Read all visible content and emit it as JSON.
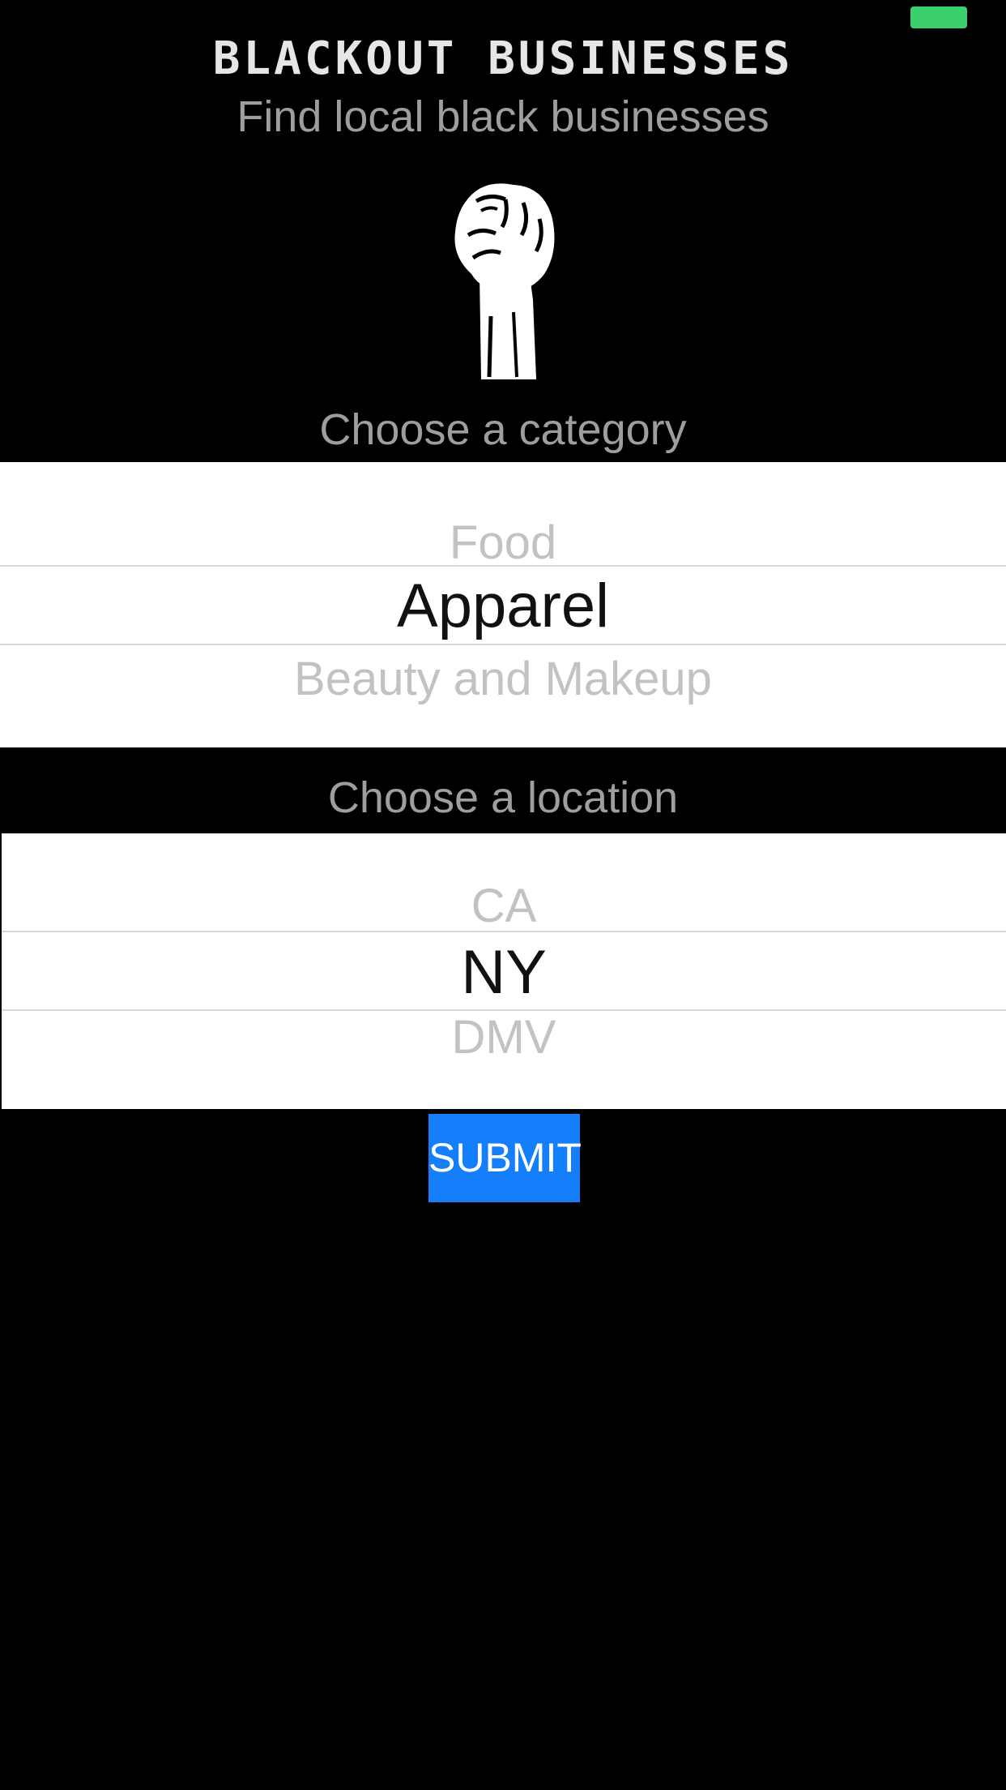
{
  "colors": {
    "background": "#000000",
    "battery": "#3ccf6e",
    "submit_background": "#147efb",
    "title_text": "#e6e6e6",
    "label_text": "#9e9e9e",
    "picker_faded_text": "#c2c2c2",
    "picker_selected_text": "#111111"
  },
  "status_bar": {
    "battery_icon": "battery-icon"
  },
  "header": {
    "title": "BLACKOUT BUSINESSES",
    "subtitle": "Find local black businesses",
    "logo_icon": "raised-fist-icon"
  },
  "category": {
    "label": "Choose a category",
    "options": [
      "Food",
      "Apparel",
      "Beauty and Makeup"
    ],
    "selected": "Apparel"
  },
  "location": {
    "label": "Choose a location",
    "options": [
      "CA",
      "NY",
      "DMV"
    ],
    "selected": "NY"
  },
  "submit_label": "SUBMIT"
}
